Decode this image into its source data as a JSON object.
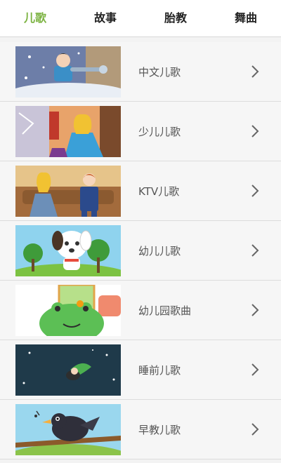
{
  "tabs": [
    {
      "label": "儿歌",
      "active": true
    },
    {
      "label": "故事",
      "active": false
    },
    {
      "label": "胎教",
      "active": false
    },
    {
      "label": "舞曲",
      "active": false
    }
  ],
  "accent_color": "#7cb342",
  "categories": [
    {
      "label": "中文儿歌",
      "thumb_icon": "snow-girl-illustration"
    },
    {
      "label": "少儿儿歌",
      "thumb_icon": "princess-illustration"
    },
    {
      "label": "KTV儿歌",
      "thumb_icon": "couple-illustration"
    },
    {
      "label": "幼儿儿歌",
      "thumb_icon": "puppy-illustration"
    },
    {
      "label": "幼儿园歌曲",
      "thumb_icon": "green-frog-illustration"
    },
    {
      "label": "睡前儿歌",
      "thumb_icon": "moon-night-illustration"
    },
    {
      "label": "早教儿歌",
      "thumb_icon": "crow-illustration"
    }
  ]
}
